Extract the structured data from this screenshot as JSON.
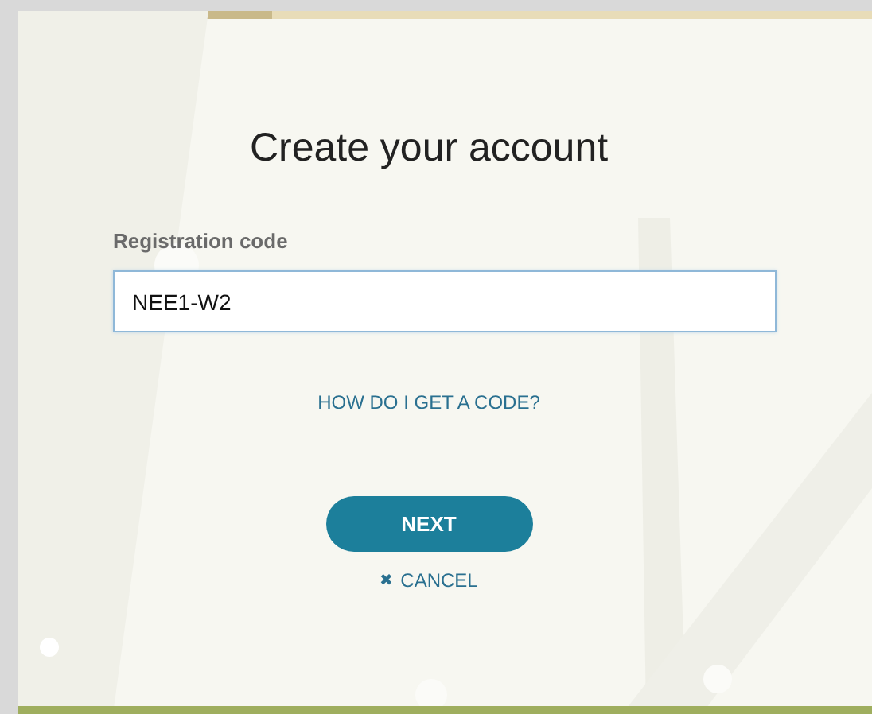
{
  "title": "Create your account",
  "registration_code": {
    "label": "Registration code",
    "value": "NEE1-W2"
  },
  "help_link": "HOW DO I GET A CODE?",
  "next_button": "NEXT",
  "cancel_link": {
    "icon": "✖",
    "label": "CANCEL"
  }
}
